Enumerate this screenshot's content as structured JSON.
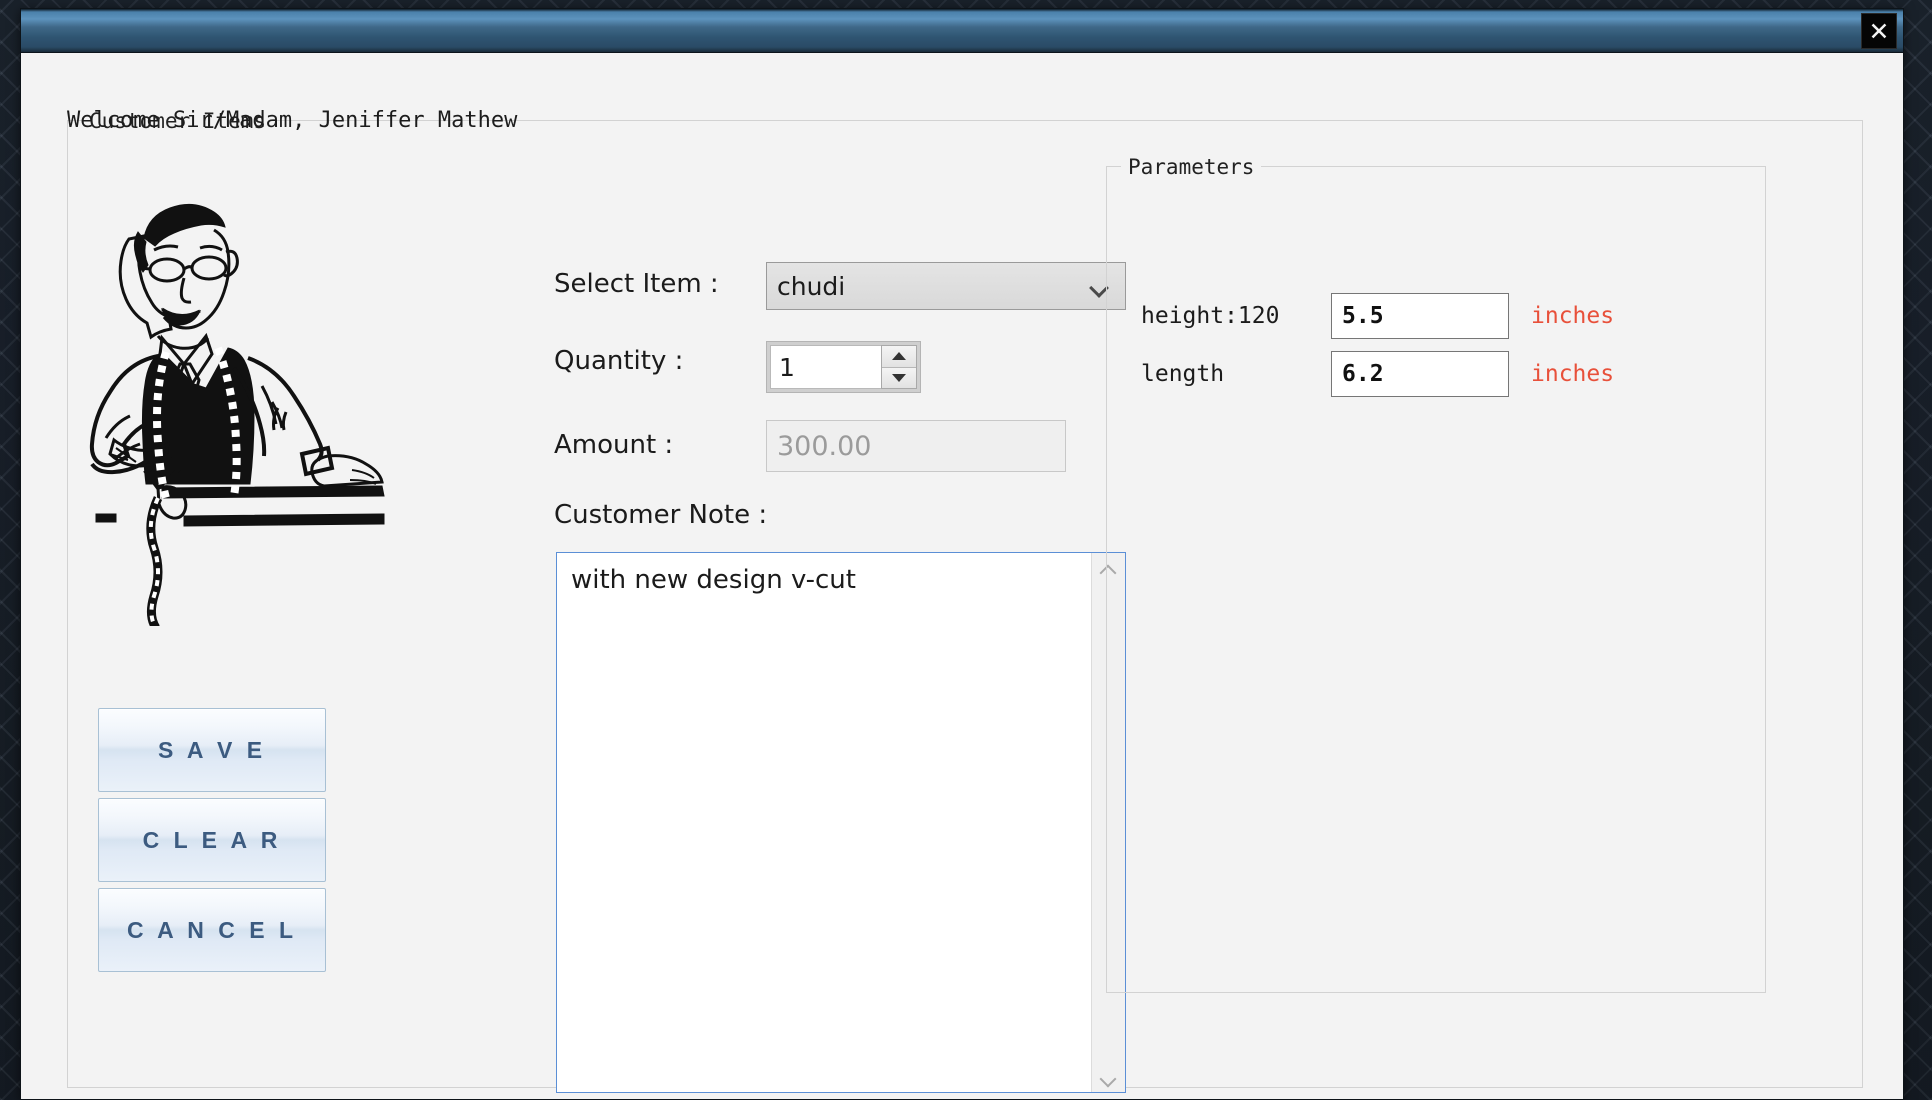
{
  "window": {
    "close_label": "✕"
  },
  "customer_items": {
    "group_title": "Customer Items",
    "welcome_text": "Welcome Sir/Madam, Jeniffer Mathew"
  },
  "illustration": {
    "name": "tailor-with-measuring-tape"
  },
  "buttons": [
    {
      "id": "save",
      "label": "S A V E"
    },
    {
      "id": "clear",
      "label": "C L E A R"
    },
    {
      "id": "cancel",
      "label": "C A N C E L"
    }
  ],
  "form": {
    "select_item": {
      "label": "Select Item :",
      "value": "chudi",
      "icon": "chevron-down-icon"
    },
    "quantity": {
      "label": "Quantity :",
      "value": "1",
      "increment_icon": "triangle-up-icon",
      "decrement_icon": "triangle-down-icon"
    },
    "amount": {
      "label": "Amount :",
      "value": "300.00"
    },
    "customer_note": {
      "label": "Customer Note :",
      "value": "with new design v-cut",
      "scroll_up_icon": "chevron-up-icon",
      "scroll_down_icon": "chevron-down-icon"
    }
  },
  "parameters": {
    "group_title": "Parameters",
    "rows": [
      {
        "label": "height:120",
        "value": "5.5",
        "unit": "inches"
      },
      {
        "label": "length",
        "value": "6.2",
        "unit": "inches"
      }
    ]
  },
  "colors": {
    "titlebar_light": "#5d93bd",
    "titlebar_dark": "#16242f",
    "unit_red": "#e8503a",
    "button_text": "#3c5b80",
    "focus_blue": "#5b8fd6"
  }
}
